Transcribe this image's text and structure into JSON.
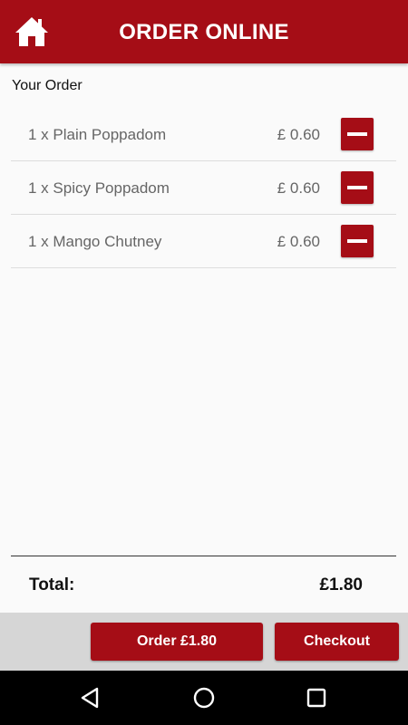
{
  "app": {
    "title": "ORDER ONLINE"
  },
  "icons": {
    "home": "home-icon",
    "remove": "minus-icon",
    "nav_back": "back-triangle-icon",
    "nav_home": "home-circle-icon",
    "nav_recent": "recent-apps-square-icon"
  },
  "order": {
    "heading": "Your Order",
    "items": [
      {
        "label": "1 x Plain Poppadom",
        "price": "£ 0.60"
      },
      {
        "label": "1 x Spicy Poppadom",
        "price": "£ 0.60"
      },
      {
        "label": "1 x Mango Chutney",
        "price": "£ 0.60"
      }
    ]
  },
  "total": {
    "label": "Total:",
    "value": "£1.80"
  },
  "actions": {
    "order_label": "Order £1.80",
    "checkout_label": "Checkout"
  },
  "colors": {
    "brand_red": "#a50d16",
    "background": "#fafafa",
    "action_bar": "#d6d6d6",
    "nav_bar": "#000000"
  }
}
